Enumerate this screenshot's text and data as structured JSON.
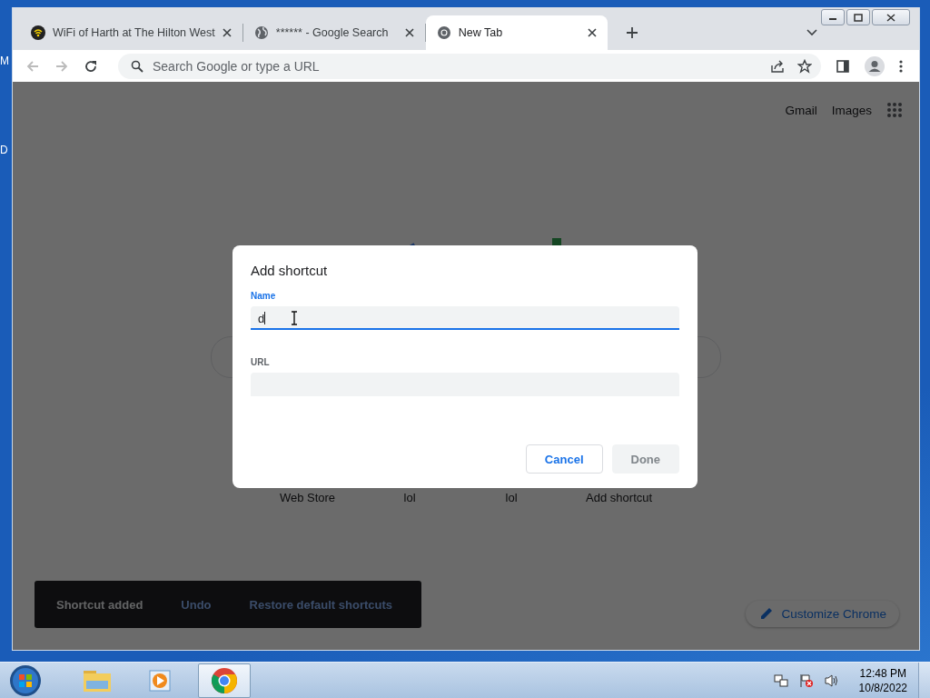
{
  "desktop_labels": [
    "M",
    "D"
  ],
  "browser": {
    "tabs": [
      {
        "title": "WiFi of Harth at The Hilton West",
        "kind": "wifi",
        "selected": false
      },
      {
        "title": "****** - Google Search",
        "kind": "globe",
        "selected": false
      },
      {
        "title": "New Tab",
        "kind": "chrome",
        "selected": true
      }
    ],
    "address": {
      "placeholder": "Search Google or type a URL"
    }
  },
  "page": {
    "links": [
      "Gmail",
      "Images"
    ],
    "shortcuts": [
      "Web Store",
      "lol",
      "lol",
      "Add shortcut"
    ],
    "toast": {
      "message": "Shortcut added",
      "actions": [
        "Undo",
        "Restore default shortcuts"
      ]
    },
    "customize_button": "Customize Chrome"
  },
  "dialog": {
    "title": "Add shortcut",
    "fields": [
      {
        "label": "Name",
        "value": "d",
        "focused": true
      },
      {
        "label": "URL",
        "focused": false
      }
    ],
    "buttons": [
      {
        "label": "Cancel",
        "disabled": false
      },
      {
        "label": "Done",
        "disabled": true
      }
    ]
  },
  "taskbar": {
    "apps": [
      {
        "kind": "folder",
        "selected": false
      },
      {
        "kind": "media",
        "selected": false
      },
      {
        "kind": "chrome",
        "selected": true
      }
    ],
    "time": "12:48 PM",
    "date": "10/8/2022"
  }
}
